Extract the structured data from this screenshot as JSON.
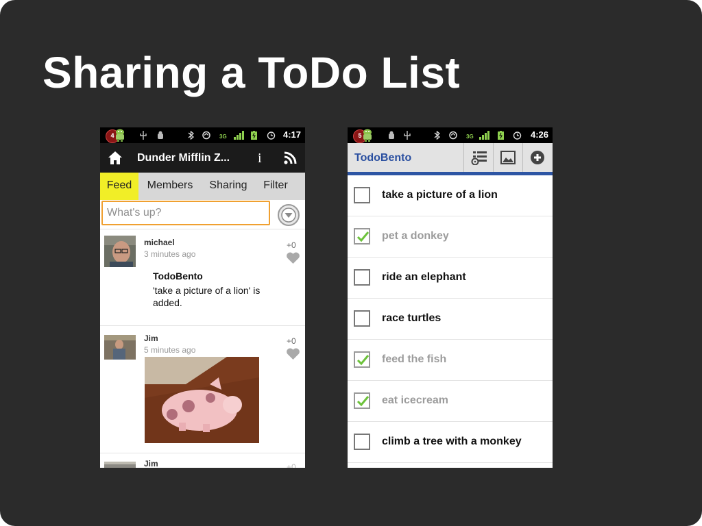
{
  "slide": {
    "title": "Sharing a ToDo List"
  },
  "left_phone": {
    "status_bar": {
      "time": "4:17",
      "notification_count": "4"
    },
    "action_bar": {
      "title": "Dunder Mifflin Z...",
      "info_label": "i",
      "home_icon": "home-icon",
      "info_icon": "info-icon",
      "rss_icon": "rss-icon"
    },
    "tabs": [
      {
        "label": "Feed",
        "active": true
      },
      {
        "label": "Members",
        "active": false
      },
      {
        "label": "Sharing",
        "active": false
      },
      {
        "label": "Filter",
        "active": false
      }
    ],
    "status_input": {
      "placeholder": "What's up?"
    },
    "posts": [
      {
        "author": "michael",
        "time": "3 minutes ago",
        "plus": "+0",
        "app": "TodoBento",
        "text": "'take a picture of a lion' is added."
      },
      {
        "author": "Jim",
        "time": "5 minutes ago",
        "plus": "+0"
      },
      {
        "author": "Jim",
        "time": "",
        "plus": "+0"
      }
    ]
  },
  "right_phone": {
    "status_bar": {
      "time": "4:26",
      "notification_count": "5"
    },
    "action_bar": {
      "title": "TodoBento",
      "icons": [
        "list-settings-icon",
        "picture-icon",
        "add-icon"
      ]
    },
    "todos": [
      {
        "label": "take a picture of a lion",
        "checked": false
      },
      {
        "label": "pet a donkey",
        "checked": true
      },
      {
        "label": "ride an elephant",
        "checked": false
      },
      {
        "label": "race turtles",
        "checked": false
      },
      {
        "label": "feed the fish",
        "checked": true
      },
      {
        "label": "eat icecream",
        "checked": true
      },
      {
        "label": "climb a tree with a monkey",
        "checked": false
      }
    ]
  },
  "colors": {
    "slide_background": "#2b2b2b",
    "tab_active": "#f1ee27",
    "input_focus_border": "#f0a030",
    "todo_title": "#2a4fa0",
    "action_bar_strip": "#2d55a4",
    "check_green": "#6cc23a"
  }
}
